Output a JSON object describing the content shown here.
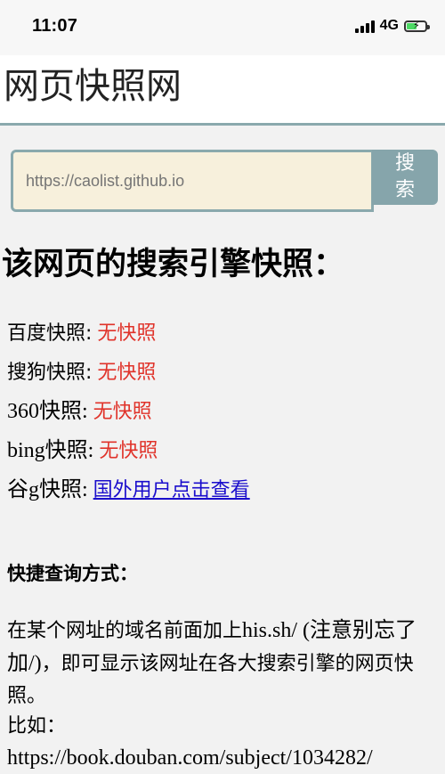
{
  "status_bar": {
    "time": "11:07",
    "network": "4G",
    "battery_level": 0.6
  },
  "header": {
    "title": "网页快照网"
  },
  "search": {
    "placeholder": "https://caolist.github.io",
    "button_label_line1": "搜",
    "button_label_line2": "索"
  },
  "snapshot_section": {
    "heading": "该网页的搜索引擎快照：",
    "engines": [
      {
        "name": "百度快照:",
        "value": "无快照"
      },
      {
        "name": "搜狗快照:",
        "value": "无快照"
      },
      {
        "name": "360快照:",
        "value": "无快照"
      },
      {
        "name": "bing快照:",
        "value": "无快照"
      },
      {
        "name": "谷g快照:",
        "value": "国外用户点击查看"
      }
    ]
  },
  "quick_query": {
    "heading": "快捷查询方式：",
    "desc_part1": "在某个网址的域名前面加上",
    "desc_code": "his.sh/ (注意别忘了加/)",
    "desc_part2": "，即可显示该网址在各大搜索引擎的网页快照。",
    "example_label": "比如：",
    "example_url": "https://book.douban.com/subject/1034282/"
  },
  "colors": {
    "accent": "#86a5ab",
    "input_bg": "#f7f0dc",
    "no_snapshot": "#e0332a",
    "link": "#1a0dcc"
  }
}
